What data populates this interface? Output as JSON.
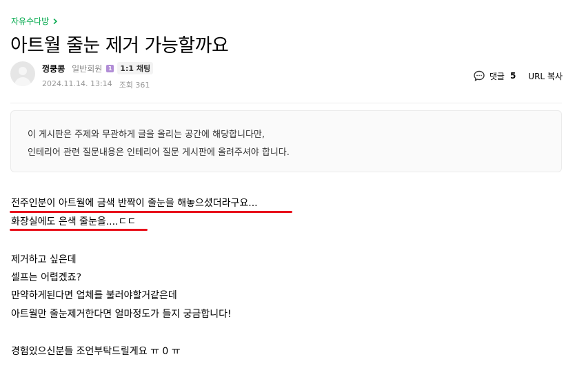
{
  "breadcrumb": {
    "board_name": "자유수다방"
  },
  "post": {
    "title": "아트월 줄눈 제거 가능할까요",
    "author": {
      "nickname": "껑쿵콩",
      "grade": "일반회원",
      "grade_badge": "1",
      "chat_label": "1:1 채팅"
    },
    "date": "2024.11.14. 13:14",
    "views": "조회 361",
    "comment_label": "댓글",
    "comment_count": "5",
    "url_copy_label": "URL 복사"
  },
  "notice": {
    "line1": "이 게시판은 주제와 무관하게 글을 올리는 공간에 해당합니다만,",
    "line2": "인테리어 관련 질문내용은 인테리어 질문 게시판에 올려주셔야 합니다."
  },
  "body": {
    "line1": "전주인분이 아트월에 금색 반짝이 줄눈을 해놓으셨더라구요...",
    "line2": "화장실에도 은색 줄눈을....ㄷㄷ",
    "line3": "제거하고 싶은데",
    "line4": "셀프는 어렵겠죠?",
    "line5": "만약하게된다면 업체를 불러야할거같은데",
    "line6": "아트월만 줄눈제거한다면 얼마정도가 들지 궁금합니다!",
    "line7": "경험있으신분들 조언부탁드릴게요 ㅠ 0 ㅠ"
  },
  "colors": {
    "accent_green": "#03a94d",
    "underline_red": "#e8111b",
    "badge_purple": "#b18dd6"
  }
}
